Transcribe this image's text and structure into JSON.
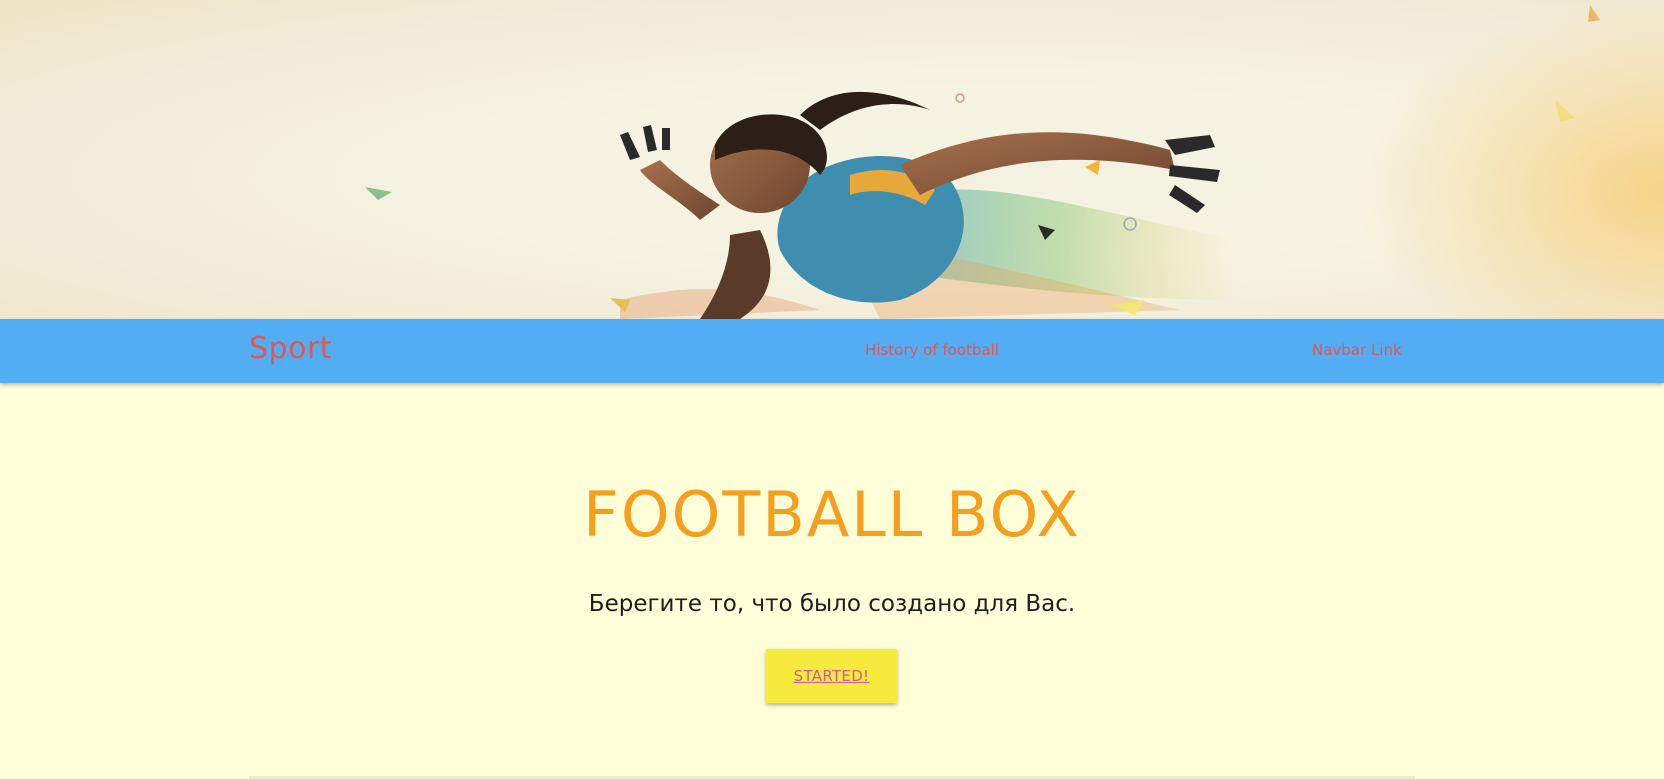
{
  "hero": {
    "image_description_icon": "sprinter-illustration"
  },
  "navbar": {
    "brand": "Sport",
    "links": [
      {
        "label": "History of football"
      },
      {
        "label": "Navbar Link"
      }
    ],
    "background_color": "#52adf5",
    "link_color": "#e4574e"
  },
  "main": {
    "title": "FOOTBALL BOX",
    "subtitle": "Берегите то, что было создано для Вас.",
    "cta_label": "STARTED!",
    "title_color": "#f4a01e",
    "cta_background": "#f6ea3c",
    "page_background": "#fefed8"
  }
}
